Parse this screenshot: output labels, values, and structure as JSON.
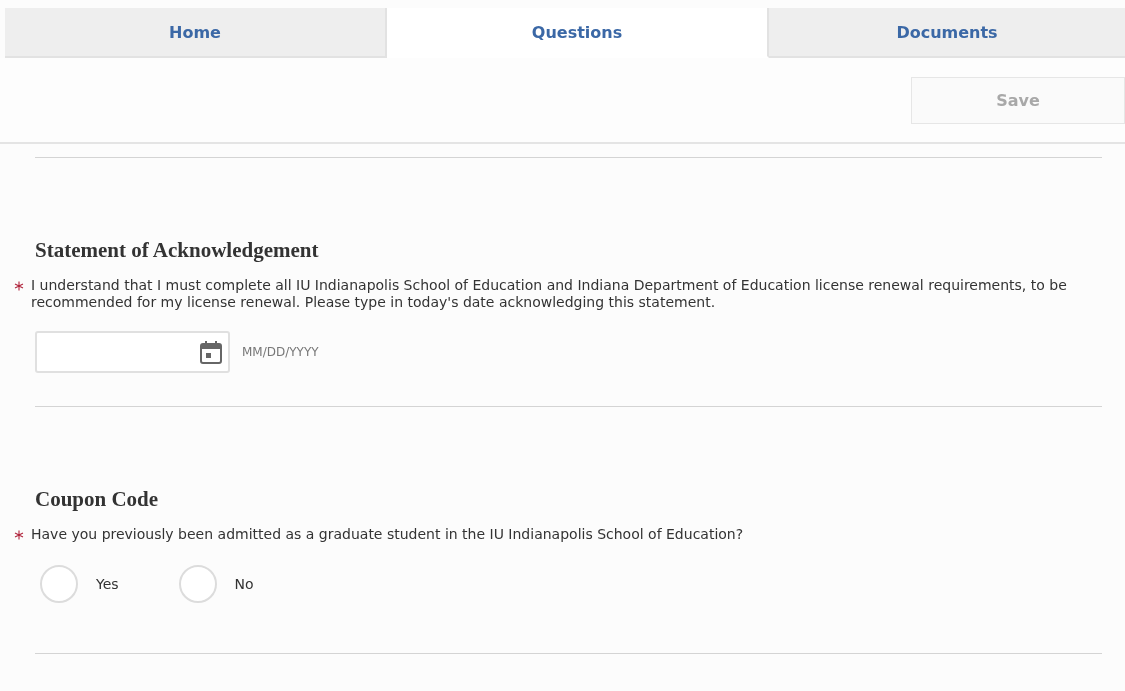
{
  "tabs": [
    {
      "label": "Home",
      "selected": false
    },
    {
      "label": "Questions",
      "selected": true
    },
    {
      "label": "Documents",
      "selected": false
    }
  ],
  "toolbar": {
    "save_button": {
      "label": "Save",
      "disabled": true
    }
  },
  "sections": [
    {
      "title": "Statement of Acknowledgement",
      "kind": "date",
      "required": true,
      "question": "I understand that I must complete all IU Indianapolis School of Education and Indiana Department of Education license renewal requirements, to be recommended for my license renewal. Please type in today's date acknowledging this statement.",
      "field": {
        "format_hint": "MM/DD/YYYY"
      }
    },
    {
      "title": "Coupon Code",
      "kind": "radio",
      "required": true,
      "question": "Have you previously been admitted as a graduate student in the IU Indianapolis School of Education?",
      "options": [
        {
          "label": "Yes",
          "selected": false
        },
        {
          "label": "No",
          "selected": false
        }
      ]
    }
  ]
}
